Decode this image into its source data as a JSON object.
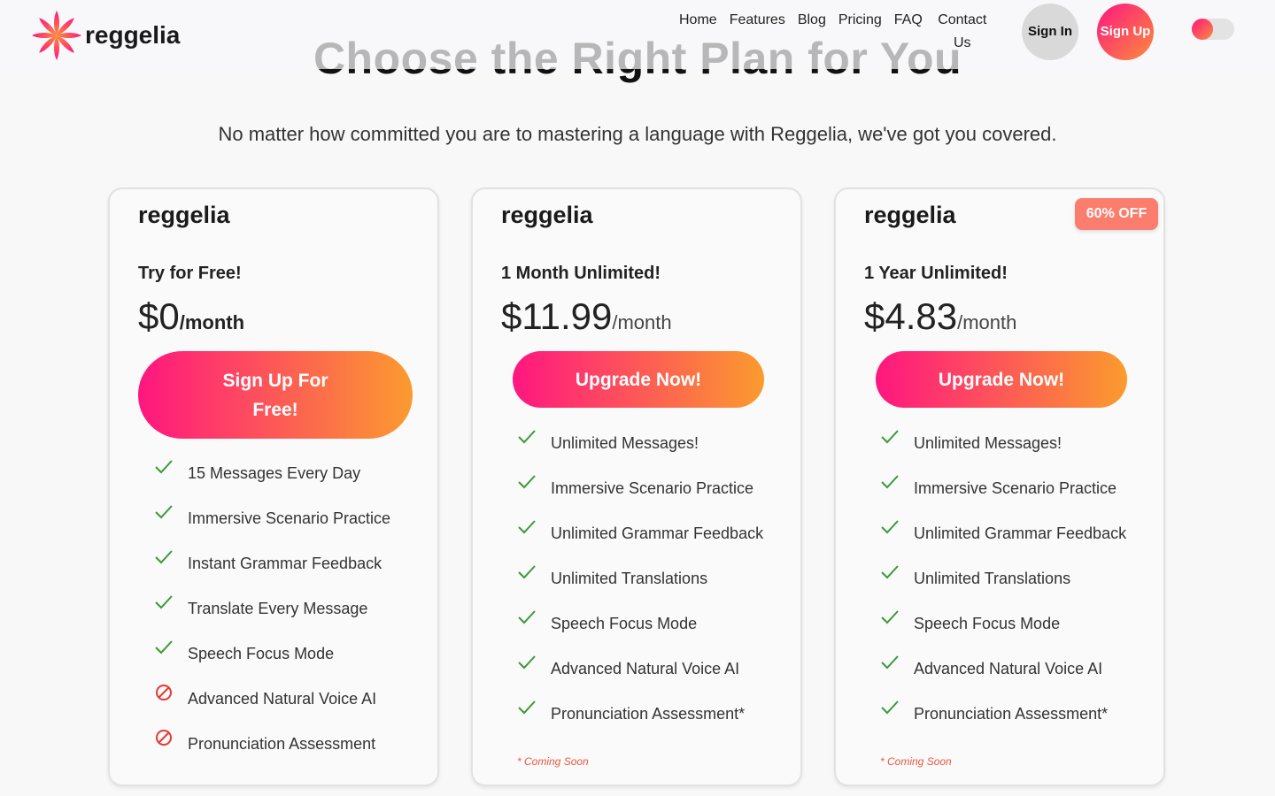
{
  "hero": {
    "title": "Choose the Right Plan for You",
    "subtitle": "No matter how committed you are to mastering a language with Reggelia, we've got you covered."
  },
  "nav": {
    "brand": "reggelia",
    "links": [
      "Home",
      "Features",
      "Blog",
      "Pricing",
      "FAQ",
      "Contact Us"
    ],
    "sign_in": "Sign In",
    "sign_up": "Sign Up",
    "logo_icon": "flower-logo-icon",
    "theme_toggle_icon": "theme-toggle-icon"
  },
  "colors": {
    "gradient_start": "#ff1680",
    "gradient_end": "#fb9b2e",
    "check": "#3a9a3a",
    "blocked": "#e53935",
    "badge": "#fb7d6e",
    "note": "#e9573f"
  },
  "plans": [
    {
      "brand": "reggelia",
      "name": "Try for Free!",
      "price": "$0",
      "unit": "/month",
      "cta": "Sign Up For Free!",
      "features": [
        {
          "label": "15 Messages Every Day",
          "included": true
        },
        {
          "label": "Immersive Scenario Practice",
          "included": true
        },
        {
          "label": "Instant Grammar Feedback",
          "included": true
        },
        {
          "label": "Translate Every Message",
          "included": true
        },
        {
          "label": "Speech Focus Mode",
          "included": true
        },
        {
          "label": "Advanced Natural Voice AI",
          "included": false
        },
        {
          "label": "Pronunciation Assessment",
          "included": false
        }
      ]
    },
    {
      "brand": "reggelia",
      "name": "1 Month Unlimited!",
      "price": "$11.99",
      "unit": "/month",
      "cta": "Upgrade Now!",
      "features": [
        {
          "label": "Unlimited Messages!",
          "included": true
        },
        {
          "label": "Immersive Scenario Practice",
          "included": true
        },
        {
          "label": "Unlimited Grammar Feedback",
          "included": true
        },
        {
          "label": "Unlimited Translations",
          "included": true
        },
        {
          "label": "Speech Focus Mode",
          "included": true
        },
        {
          "label": "Advanced Natural Voice AI",
          "included": true
        },
        {
          "label": "Pronunciation Assessment*",
          "included": true
        }
      ],
      "note": "* Coming Soon"
    },
    {
      "brand": "reggelia",
      "name": "1 Year Unlimited!",
      "price": "$4.83",
      "unit": "/month",
      "badge": "60% OFF",
      "cta": "Upgrade Now!",
      "features": [
        {
          "label": "Unlimited Messages!",
          "included": true
        },
        {
          "label": "Immersive Scenario Practice",
          "included": true
        },
        {
          "label": "Unlimited Grammar Feedback",
          "included": true
        },
        {
          "label": "Unlimited Translations",
          "included": true
        },
        {
          "label": "Speech Focus Mode",
          "included": true
        },
        {
          "label": "Advanced Natural Voice AI",
          "included": true
        },
        {
          "label": "Pronunciation Assessment*",
          "included": true
        }
      ],
      "note": "* Coming Soon"
    }
  ]
}
